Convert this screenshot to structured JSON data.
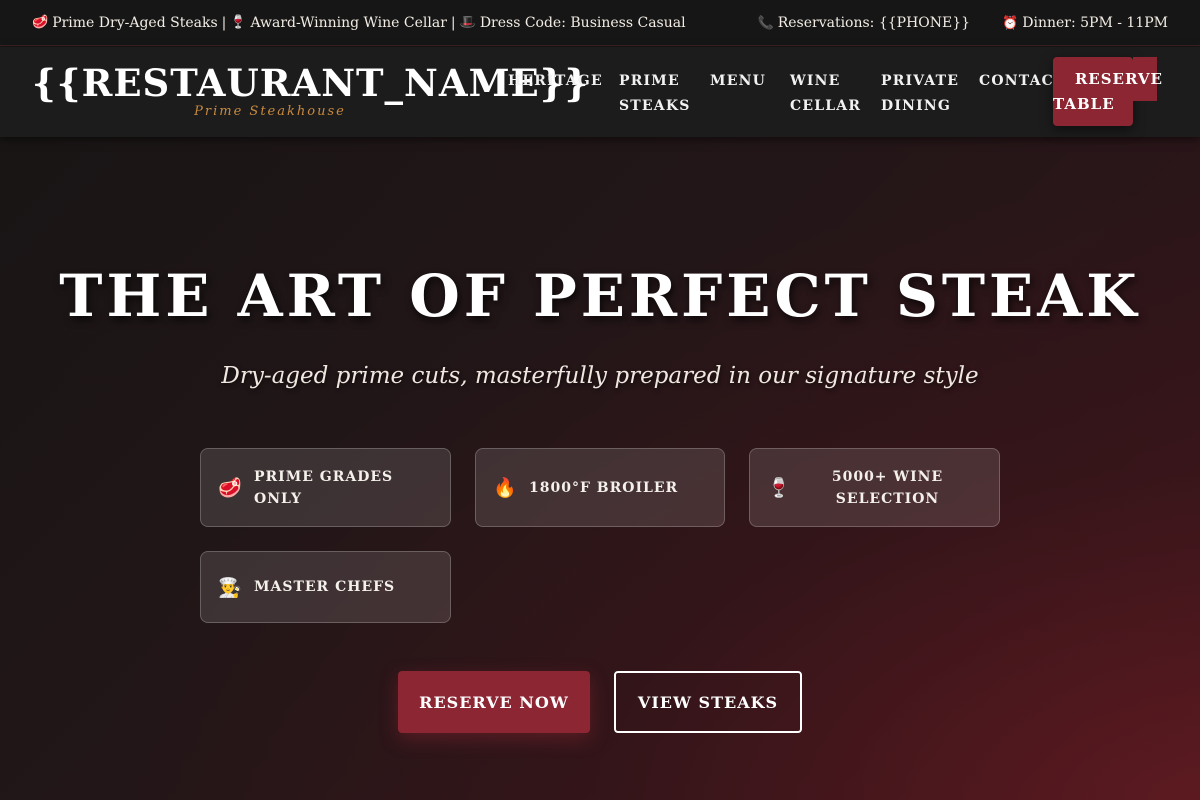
{
  "topbar": {
    "left": [
      {
        "icon": "🥩",
        "icon_name": "steak-icon",
        "text": "Prime Dry-Aged Steaks"
      },
      {
        "icon": "🍷",
        "icon_name": "wine-glass-icon",
        "text": "Award-Winning Wine Cellar"
      },
      {
        "icon": "🎩",
        "icon_name": "top-hat-icon",
        "text": "Dress Code: Business Casual"
      }
    ],
    "separator": "|",
    "reservations": {
      "icon": "📞",
      "icon_name": "phone-icon",
      "text": "Reservations: {{PHONE}}"
    },
    "hours": {
      "icon": "⏰",
      "icon_name": "alarm-clock-icon",
      "text": "Dinner: 5PM - 11PM"
    }
  },
  "header": {
    "brand_name": "{{RESTAURANT_NAME}}",
    "brand_tagline": "Prime Steakhouse",
    "nav": [
      {
        "line1": "HERITAGE",
        "line2": ""
      },
      {
        "line1": "PRIME",
        "line2": "STEAKS"
      },
      {
        "line1": "MENU",
        "line2": ""
      },
      {
        "line1": "WINE",
        "line2": "CELLAR"
      },
      {
        "line1": "PRIVATE",
        "line2": "DINING"
      },
      {
        "line1": "CONTACT",
        "line2": ""
      }
    ],
    "reserve_button": {
      "line1": "RESERVE",
      "line2": "TABLE"
    }
  },
  "hero": {
    "title": "THE ART OF PERFECT STEAK",
    "subtitle": "Dry-aged prime cuts, masterfully prepared in our signature style",
    "features": [
      {
        "icon": "🥩",
        "icon_name": "steak-icon",
        "text": "PRIME GRADES ONLY"
      },
      {
        "icon": "🔥",
        "icon_name": "fire-icon",
        "text": "1800°F BROILER"
      },
      {
        "icon": "🍷",
        "icon_name": "wine-glass-icon",
        "text": "5000+ WINE SELECTION",
        "line1": "5000+ WINE",
        "line2": "SELECTION"
      },
      {
        "icon": "👨‍🍳",
        "icon_name": "chef-icon",
        "text": "MASTER CHEFS"
      }
    ],
    "primary_button": "RESERVE NOW",
    "secondary_button": "VIEW STEAKS"
  },
  "colors": {
    "accent": "#8c2633",
    "tagline": "#c8893f",
    "topbar_bg": "#161616",
    "header_bg": "#1c1c1c"
  }
}
